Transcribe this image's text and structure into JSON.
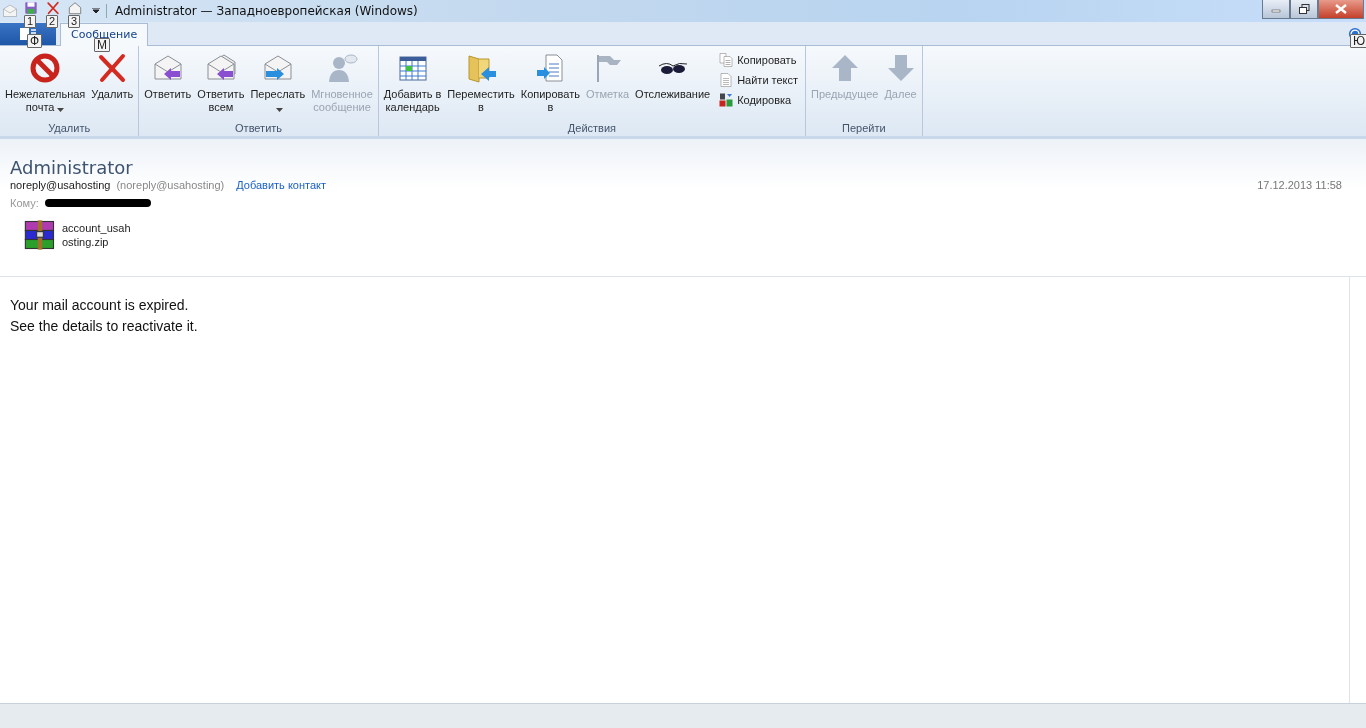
{
  "window": {
    "title": "Administrator — Западноевропейская (Windows)"
  },
  "quick_access": [
    {
      "kind": "save",
      "keytip": "1"
    },
    {
      "kind": "delete",
      "keytip": "2"
    },
    {
      "kind": "home",
      "keytip": "3"
    }
  ],
  "file_button": {
    "keytip": "Ф"
  },
  "tabs": [
    {
      "label": "Сообщение",
      "selected": true,
      "keytip": "М"
    }
  ],
  "help": {
    "keytip": "Ю"
  },
  "ribbon": [
    {
      "label": "Удалить",
      "items": [
        {
          "kind": "large",
          "lines": [
            "Нежелательная",
            "почта"
          ],
          "dropdown": true,
          "disabled": false
        },
        {
          "kind": "large",
          "lines": [
            "Удалить"
          ],
          "dropdown": false,
          "disabled": false
        }
      ]
    },
    {
      "label": "Ответить",
      "items": [
        {
          "kind": "large",
          "lines": [
            "Ответить"
          ],
          "dropdown": false,
          "disabled": false
        },
        {
          "kind": "large",
          "lines": [
            "Ответить",
            "всем"
          ],
          "dropdown": false,
          "disabled": false
        },
        {
          "kind": "large",
          "lines": [
            "Переслать"
          ],
          "dropdown": true,
          "disabled": false
        },
        {
          "kind": "large",
          "lines": [
            "Мгновенное",
            "сообщение"
          ],
          "dropdown": false,
          "disabled": true
        }
      ]
    },
    {
      "label": "Действия",
      "items": [
        {
          "kind": "large",
          "lines": [
            "Добавить в",
            "календарь"
          ],
          "dropdown": false,
          "disabled": false
        },
        {
          "kind": "large",
          "lines": [
            "Переместить",
            "в"
          ],
          "dropdown": false,
          "disabled": false
        },
        {
          "kind": "large",
          "lines": [
            "Копировать",
            "в"
          ],
          "dropdown": false,
          "disabled": false
        },
        {
          "kind": "large",
          "lines": [
            "Отметка"
          ],
          "dropdown": false,
          "disabled": true
        },
        {
          "kind": "large",
          "lines": [
            "Отслеживание"
          ],
          "dropdown": false,
          "disabled": false
        },
        {
          "kind": "stack",
          "buttons": [
            {
              "label": "Копировать"
            },
            {
              "label": "Найти текст"
            },
            {
              "label": "Кодировка"
            }
          ]
        }
      ]
    },
    {
      "label": "Перейти",
      "items": [
        {
          "kind": "large",
          "lines": [
            "Предыдущее"
          ],
          "dropdown": false,
          "disabled": true
        },
        {
          "kind": "large",
          "lines": [
            "Далее"
          ],
          "dropdown": false,
          "disabled": true
        }
      ]
    }
  ],
  "message": {
    "from_name": "Administrator",
    "from_address": "noreply@usahosting",
    "from_address_paren": "(noreply@usahosting)",
    "add_contact": "Добавить контакт",
    "date": "17.12.2013 11:58",
    "to_label": "Кому:",
    "recipient_redacted": true,
    "attachments": [
      {
        "lines": [
          "account_usah",
          "osting.zip"
        ]
      }
    ],
    "body": [
      "Your mail account is expired.",
      "See the details to reactivate it."
    ]
  }
}
